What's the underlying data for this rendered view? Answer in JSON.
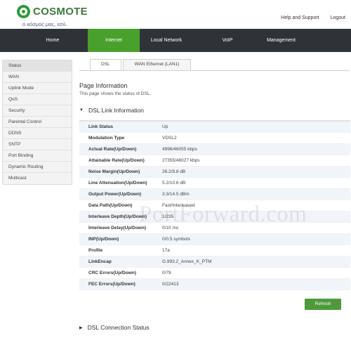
{
  "brand": {
    "name": "COSMOTE",
    "tagline": "ο κόσμος μας, εσύ."
  },
  "toplinks": {
    "help": "Help and Support",
    "logout": "Logout"
  },
  "nav": [
    {
      "label": "Home",
      "active": false
    },
    {
      "label": "Internet",
      "active": true
    },
    {
      "label": "Local Network",
      "active": false
    },
    {
      "label": "VoIP",
      "active": false
    },
    {
      "label": "Management",
      "active": false
    }
  ],
  "sidebar": [
    {
      "label": "Status",
      "active": true
    },
    {
      "label": "WAN",
      "active": false
    },
    {
      "label": "Uplink Mode",
      "active": false
    },
    {
      "label": "QoS",
      "active": false
    },
    {
      "label": "Security",
      "active": false
    },
    {
      "label": "Parental Control",
      "active": false
    },
    {
      "label": "DDNS",
      "active": false
    },
    {
      "label": "SNTP",
      "active": false
    },
    {
      "label": "Port Binding",
      "active": false
    },
    {
      "label": "Dynamic Routing",
      "active": false
    },
    {
      "label": "Multicast",
      "active": false
    }
  ],
  "tabs": [
    {
      "label": "DSL",
      "active": true
    },
    {
      "label": "WAN Ethernet (LAN1)",
      "active": false
    }
  ],
  "page": {
    "title": "Page Information",
    "description": "This page shows the status of DSL.",
    "section1": "DSL Link Information",
    "section2": "DSL Connection Status",
    "refresh_label": "Refresh"
  },
  "dsl_info": [
    {
      "key": "Link Status",
      "value": "Up"
    },
    {
      "key": "Modulation Type",
      "value": "VDSL2"
    },
    {
      "key": "Actual Rate(Up/Down)",
      "value": "4996/46055 kbps"
    },
    {
      "key": "Attainable Rate(Up/Down)",
      "value": "27355/48027 kbps"
    },
    {
      "key": "Noise Margin(Up/Down)",
      "value": "26.2/9.8 dB"
    },
    {
      "key": "Line Attenuation(Up/Down)",
      "value": "5.2/10.6 dB"
    },
    {
      "key": "Output Power(Up/Down)",
      "value": "3.3/14.5 dBm"
    },
    {
      "key": "Data Path(Up/Down)",
      "value": "Fast/Interleaved"
    },
    {
      "key": "Interleave Depth(Up/Down)",
      "value": "1/235"
    },
    {
      "key": "Interleave Delay(Up/Down)",
      "value": "0/10 ms"
    },
    {
      "key": "INP(Up/Down)",
      "value": "0/0.5 symbols"
    },
    {
      "key": "Profile",
      "value": "17a"
    },
    {
      "key": "LinkEncap",
      "value": "G.993.2_Annex_K_PTM"
    },
    {
      "key": "CRC Errors(Up/Down)",
      "value": "0/79"
    },
    {
      "key": "FEC Errors(Up/Down)",
      "value": "0/22413"
    }
  ],
  "watermark": "PortForward.com",
  "colors": {
    "brand_green": "#4aa02c",
    "navbar": "#2f3338",
    "button": "#4e9a3a"
  }
}
